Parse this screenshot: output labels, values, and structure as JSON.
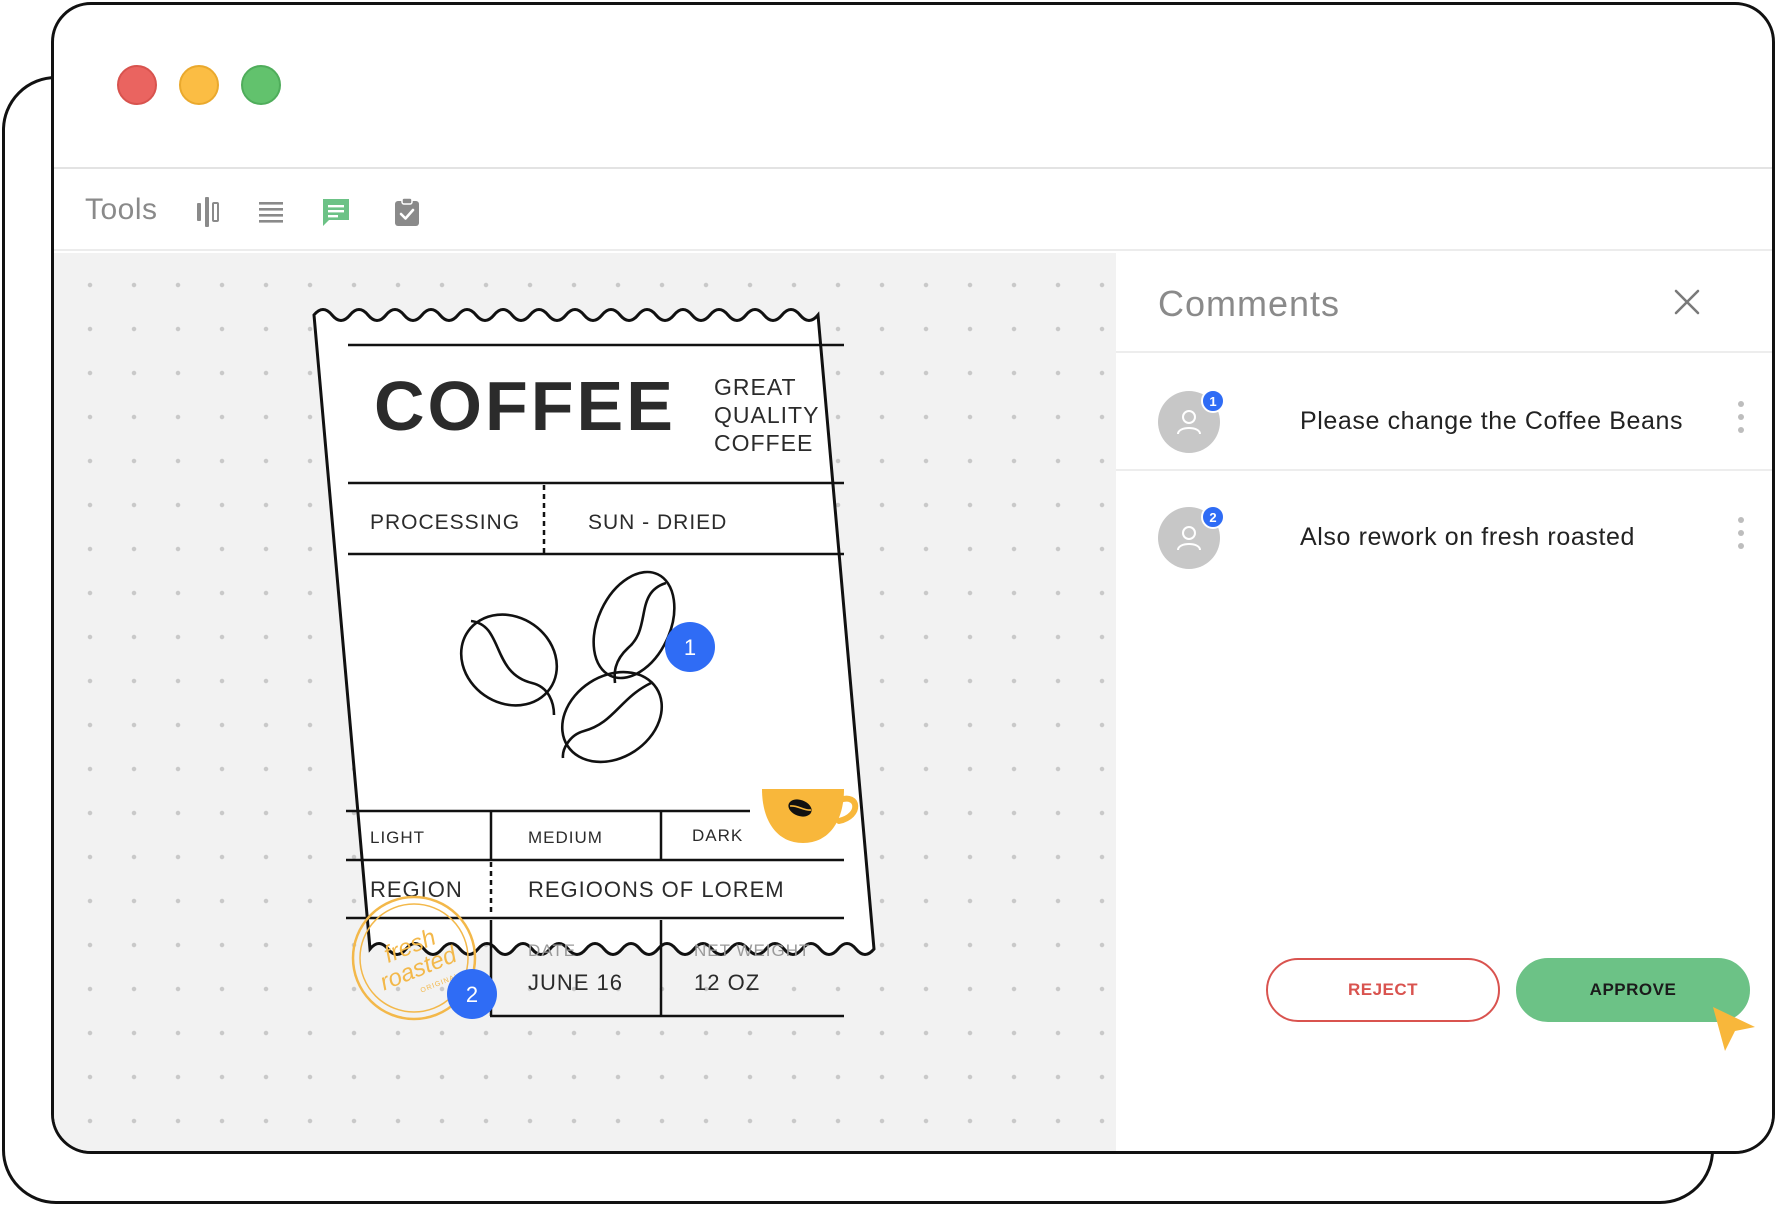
{
  "toolbar": {
    "label": "Tools",
    "tools": [
      {
        "name": "columns-tool-icon"
      },
      {
        "name": "text-lines-tool-icon"
      },
      {
        "name": "comment-tool-icon",
        "active": true,
        "color": "#6cc286"
      },
      {
        "name": "clipboard-check-tool-icon"
      }
    ]
  },
  "label": {
    "title": "COFFEE",
    "tagline_1": "GREAT",
    "tagline_2": "QUALITY",
    "tagline_3": "COFFEE",
    "processing_label": "PROCESSING",
    "processing_value": "SUN - DRIED",
    "roast_light": "LIGHT",
    "roast_medium": "MEDIUM",
    "roast_dark": "DARK",
    "region_label": "REGION",
    "region_value": "REGIOONS OF LOREM",
    "date_label": "DATE",
    "date_value": "JUNE 16",
    "weight_label": "NET WEIGHT",
    "weight_value": "12 OZ",
    "stamp_line_1": "fresh",
    "stamp_line_2": "roasted",
    "stamp_line_3": "ORIGINAL"
  },
  "pins": [
    {
      "number": "1"
    },
    {
      "number": "2"
    }
  ],
  "comments_panel": {
    "title": "Comments",
    "comments": [
      {
        "badge": "1",
        "text": "Please change the Coffee Beans"
      },
      {
        "badge": "2",
        "text": "Also rework on fresh roasted"
      }
    ],
    "reject_label": "REJECT",
    "approve_label": "APPROVE"
  },
  "colors": {
    "pin_blue": "#2f6cf5",
    "accent_green": "#6cc286",
    "reject_red": "#d9534f",
    "mug_yellow": "#f8b73b"
  }
}
